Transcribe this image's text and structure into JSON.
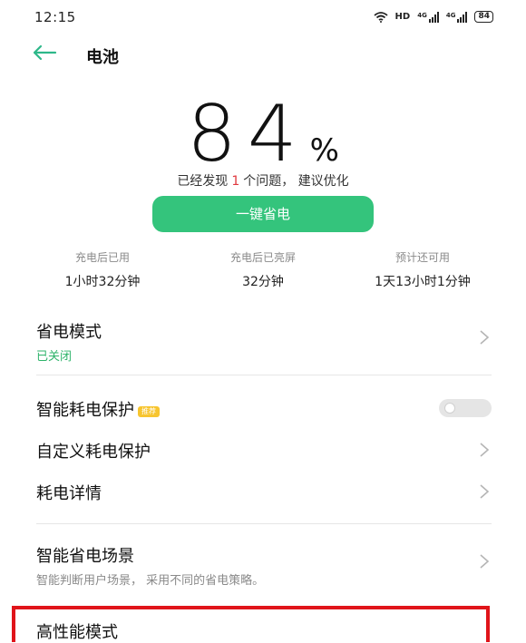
{
  "status_bar": {
    "time": "12:15",
    "hd": "HD",
    "signal1": "4G",
    "signal2": "4G",
    "battery": "84"
  },
  "header": {
    "title": "电池"
  },
  "battery": {
    "level": "84",
    "unit": "%",
    "issue_prefix": "已经发现",
    "issue_count": "1",
    "issue_suffix": "个问题， 建议优化",
    "optimize_label": "一键省电"
  },
  "stats": [
    {
      "label": "充电后已用",
      "value": "1小时32分钟"
    },
    {
      "label": "充电后已亮屏",
      "value": "32分钟"
    },
    {
      "label": "预计还可用",
      "value": "1天13小时1分钟"
    }
  ],
  "settings": {
    "power_saving": {
      "title": "省电模式",
      "status": "已关闭"
    },
    "smart_protection": {
      "title": "智能耗电保护",
      "badge": "推荐",
      "toggle_on": false
    },
    "custom_protection": {
      "title": "自定义耗电保护"
    },
    "consumption_details": {
      "title": "耗电详情"
    },
    "smart_scene": {
      "title": "智能省电场景",
      "desc": "智能判断用户场景， 采用不同的省电策略。"
    },
    "high_performance": {
      "title": "高性能模式"
    }
  },
  "colors": {
    "accent_green": "#34c47c",
    "back_arrow": "#2eb88a",
    "issue_red": "#e0383e",
    "highlight_red": "#e0141a",
    "badge_yellow": "#f7c52f"
  }
}
